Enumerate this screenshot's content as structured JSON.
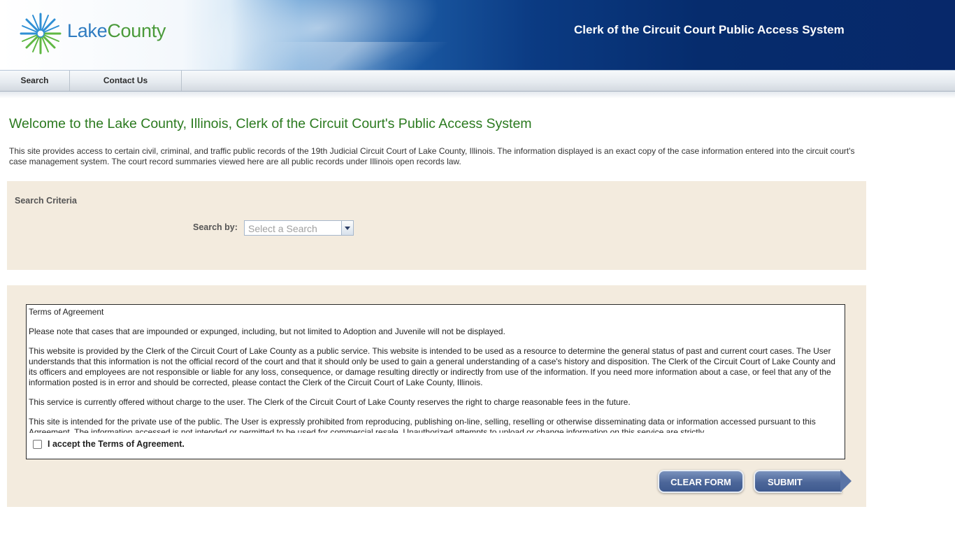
{
  "header": {
    "logo": {
      "brand": "LakeCounty",
      "icon": "lake-county-starburst-logo"
    },
    "site_title": "Clerk of the Circuit Court Public Access System"
  },
  "nav": {
    "items": [
      {
        "label": "Search"
      },
      {
        "label": "Contact Us"
      }
    ]
  },
  "main": {
    "welcome": "Welcome to the Lake County, Illinois, Clerk of the Circuit Court's Public Access System",
    "intro": "This site provides access to certain civil, criminal, and traffic public records of the 19th Judicial Circuit Court of Lake County, Illinois. The information displayed is an exact copy of the case information entered into the circuit court's case management system. The court record summaries viewed here are all public records under Illinois open records law."
  },
  "criteria": {
    "title": "Search Criteria",
    "search_by_label": "Search by:",
    "search_by_value": "Select a Search"
  },
  "terms": {
    "heading": "Terms of Agreement",
    "paragraphs": [
      "Please note that cases that are impounded or expunged, including, but not limited to Adoption and Juvenile will not be displayed.",
      "This website is provided by the Clerk of the Circuit Court of Lake County as a public service. This website is intended to be used as a resource to determine the general status of past and current court cases. The User understands that this information is not the official record of the court and that it should only be used to gain a general understanding of a case's history and disposition. The Clerk of the Circuit Court of Lake County and its officers and employees are not responsible or liable for any loss, consequence, or damage resulting directly or indirectly from use of the information. If you need more information about a case, or feel that any of the information posted is in error and should be corrected, please contact the Clerk of the Circuit Court of Lake County, Illinois.",
      "This service is currently offered without charge to the user. The Clerk of the Circuit Court of Lake County reserves the right to charge reasonable fees in the future.",
      "This site is intended for the private use of the public. The User is expressly prohibited from reproducing, publishing on-line, selling, reselling or otherwise disseminating data or information accessed pursuant to this Agreement. The information accessed is not intended or permitted to be used for commercial resale. Unauthorized attempts to upload or change information on this service are strictly"
    ],
    "accept_label": "I accept the Terms of Agreement.",
    "accept_checked": false
  },
  "actions": {
    "clear_label": "CLEAR FORM",
    "submit_label": "SUBMIT"
  },
  "colors": {
    "welcome_green": "#2b7a1f",
    "panel_beige": "#f3ebde",
    "header_navy": "#062c6d",
    "button_blue": "#4c6699"
  }
}
